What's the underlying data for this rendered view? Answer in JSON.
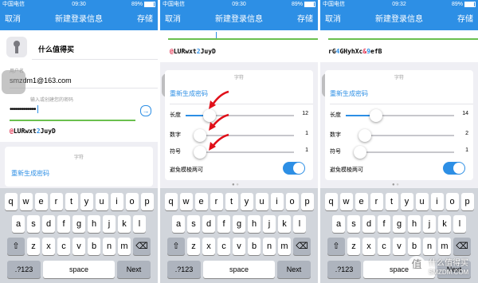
{
  "status": {
    "carrier": "中国电信",
    "battery": "89%",
    "times": [
      "09:30",
      "09:30",
      "09:32"
    ]
  },
  "nav": {
    "cancel": "取消",
    "title": "新建登录信息",
    "save": "存储"
  },
  "form": {
    "site_name": "什么值得买",
    "username_label": "用户名",
    "username_value": "smzdm1@163.com",
    "password_placeholder": "输入或创建您的密码",
    "password_dots": "•••••••••••••"
  },
  "generated_passwords": [
    [
      {
        "t": "@",
        "k": "s"
      },
      {
        "t": "LURwxt",
        "k": "l"
      },
      {
        "t": "2",
        "k": "n"
      },
      {
        "t": "JuyD",
        "k": "l"
      }
    ],
    [
      {
        "t": "@",
        "k": "s"
      },
      {
        "t": "LURwxt",
        "k": "l"
      },
      {
        "t": "2",
        "k": "n"
      },
      {
        "t": "JuyD",
        "k": "l"
      }
    ],
    [
      {
        "t": "rG",
        "k": "l"
      },
      {
        "t": "4",
        "k": "n"
      },
      {
        "t": "GHyhXc",
        "k": "l"
      },
      {
        "t": "&",
        "k": "s"
      },
      {
        "t": "9",
        "k": "n"
      },
      {
        "t": "efB",
        "k": "l"
      }
    ]
  ],
  "generator": {
    "header": "字符",
    "regenerate": "重新生成密码",
    "length_label": "长度",
    "digits_label": "数字",
    "symbols_label": "符号",
    "avoid_label": "避免模棱两可",
    "panel2": {
      "length": "12",
      "digits": "1",
      "symbols": "1",
      "length_pos": 0.22,
      "digits_pos": 0.0,
      "symbols_pos": 0.0
    },
    "panel3": {
      "length": "14",
      "digits": "2",
      "symbols": "1",
      "length_pos": 0.28,
      "digits_pos": 0.05,
      "symbols_pos": 0.0
    }
  },
  "keyboard": {
    "row1": [
      "q",
      "w",
      "e",
      "r",
      "t",
      "y",
      "u",
      "i",
      "o",
      "p"
    ],
    "row2": [
      "a",
      "s",
      "d",
      "f",
      "g",
      "h",
      "j",
      "k",
      "l"
    ],
    "row3": [
      "z",
      "x",
      "c",
      "v",
      "b",
      "n",
      "m"
    ],
    "shift": "⇧",
    "delete": "⌫",
    "numbers": ".?123",
    "space": "space",
    "next": "Next"
  },
  "watermark": {
    "brand": "什么值得买",
    "domain": "SMZDM.COM"
  },
  "colors": {
    "accent": "#2d8fe5",
    "arrow": "#e0101a",
    "symbol": "#e0304e"
  }
}
